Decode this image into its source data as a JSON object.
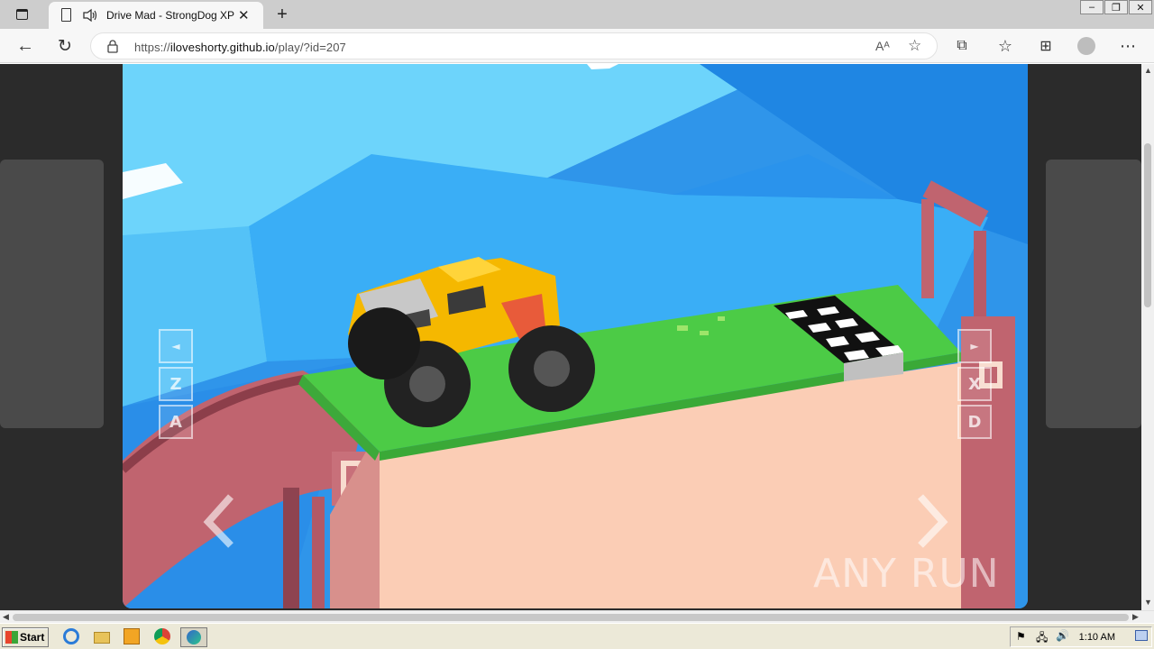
{
  "browser": {
    "tab_title": "Drive Mad - StrongDog XP",
    "url_prefix": "https://",
    "url_host": "iloveshorty.github.io",
    "url_path": "/play/?id=207"
  },
  "game": {
    "left_controls": [
      "◄",
      "Z",
      "A"
    ],
    "right_controls": [
      "►",
      "X",
      "D"
    ],
    "watermark": "ANY RUN"
  },
  "taskbar": {
    "start_label": "Start",
    "clock": "1:10 AM"
  },
  "colors": {
    "sky_light": "#6dd4fb",
    "sky_mid": "#3ab3f5",
    "sky_dark": "#1f86e3",
    "grass": "#4ccb46",
    "dirt": "#f9c9b1",
    "bridge": "#c86e78",
    "truck_yellow": "#f7c31a"
  }
}
